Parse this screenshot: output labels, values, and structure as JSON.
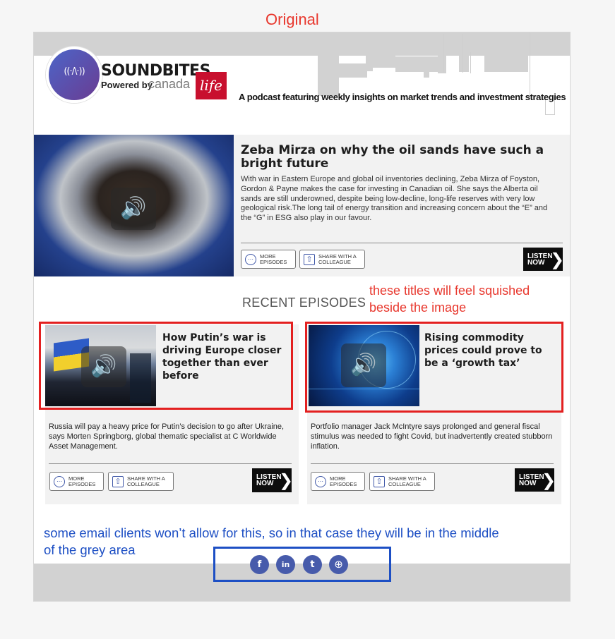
{
  "annotations": {
    "original_label": "Original",
    "titles_note": "these titles will feel squished beside the image",
    "email_note": "some email clients won’t allow for this, so in that case they will be in the middle of the grey area"
  },
  "header": {
    "brand": "SOUNDBITES",
    "powered_by": "Powered by",
    "canada": "canada",
    "life": "life",
    "tagline": "A podcast featuring weekly insights on market trends and investment strategies",
    "logo_wave": "((·/\\·))"
  },
  "featured": {
    "title": "Zeba Mirza on why the oil sands have such a bright future",
    "description": "With war in Eastern Europe and global oil inventories declining, Zeba Mirza of Foyston, Gordon & Payne makes the case for investing in Canadian oil. She says the Alberta oil sands are still underowned, despite being low-decline, long-life reserves with very low geological risk.The long tail of energy transition and increasing concern about the “E” and the “G” in ESG also play in our favour.",
    "more_episodes": "MORE EPISODES",
    "share": "SHARE WITH A COLLEAGUE",
    "listen": "LISTEN NOW"
  },
  "recent": {
    "heading": "RECENT EPISODES",
    "cards": [
      {
        "title": "How Putin’s war is driving Europe closer together than ever before",
        "description": "Russia will pay a heavy price for Putin’s decision to go after Ukraine, says Morten Springborg, global thematic specialist at C Worldwide Asset Management.",
        "more_episodes": "MORE EPISODES",
        "share": "SHARE WITH A COLLEAGUE",
        "listen": "LISTEN NOW"
      },
      {
        "title": "Rising commodity prices could prove to be a ‘growth tax’",
        "description": "Portfolio manager Jack McIntyre says prolonged and general fiscal stimulus was needed to fight Covid, but inadvertently created stubborn inflation.",
        "more_episodes": "MORE EPISODES",
        "share": "SHARE WITH A COLLEAGUE",
        "listen": "LISTEN NOW"
      }
    ]
  },
  "social": {
    "facebook": "f",
    "linkedin": "in",
    "twitter": "t",
    "web": "⊕"
  },
  "icons": {
    "speaker": "🔊",
    "chevron": "❯",
    "more": "⋯",
    "share": "⇧"
  },
  "colors": {
    "annotation_red": "#e8372d",
    "annotation_blue": "#1d4fc4",
    "brand_red": "#c8102e",
    "social_blue": "#475bab"
  }
}
